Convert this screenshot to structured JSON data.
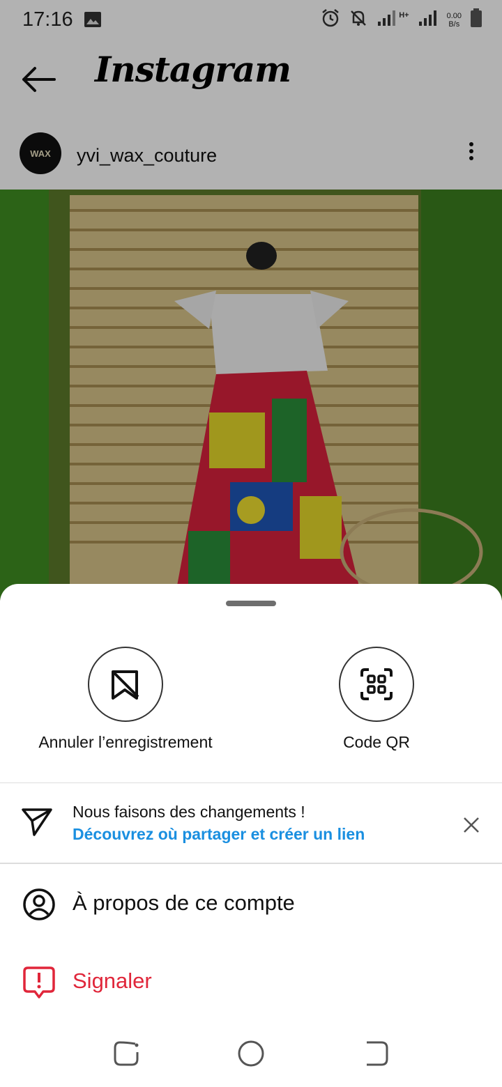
{
  "status_bar": {
    "time": "17:16",
    "net_speed_value": "0.00",
    "net_speed_unit": "B/s",
    "network_type": "H+"
  },
  "header": {
    "app_title": "Instagram"
  },
  "post": {
    "username": "yvi_wax_couture",
    "avatar_text": "WAX"
  },
  "sheet": {
    "actions": [
      {
        "label": "Annuler l’enregistrement",
        "icon": "unsave-bookmark-icon"
      },
      {
        "label": "Code QR",
        "icon": "qr-code-icon"
      }
    ],
    "notice": {
      "title": "Nous faisons des changements !",
      "link": "Découvrez où partager et créer un lien"
    },
    "items": [
      {
        "label": "À propos de ce compte",
        "icon": "account-circle-icon",
        "color": "#111111"
      },
      {
        "label": "Signaler",
        "icon": "report-icon",
        "color": "#e0263a"
      }
    ]
  },
  "colors": {
    "link": "#1a8fe0",
    "danger": "#e0263a"
  }
}
